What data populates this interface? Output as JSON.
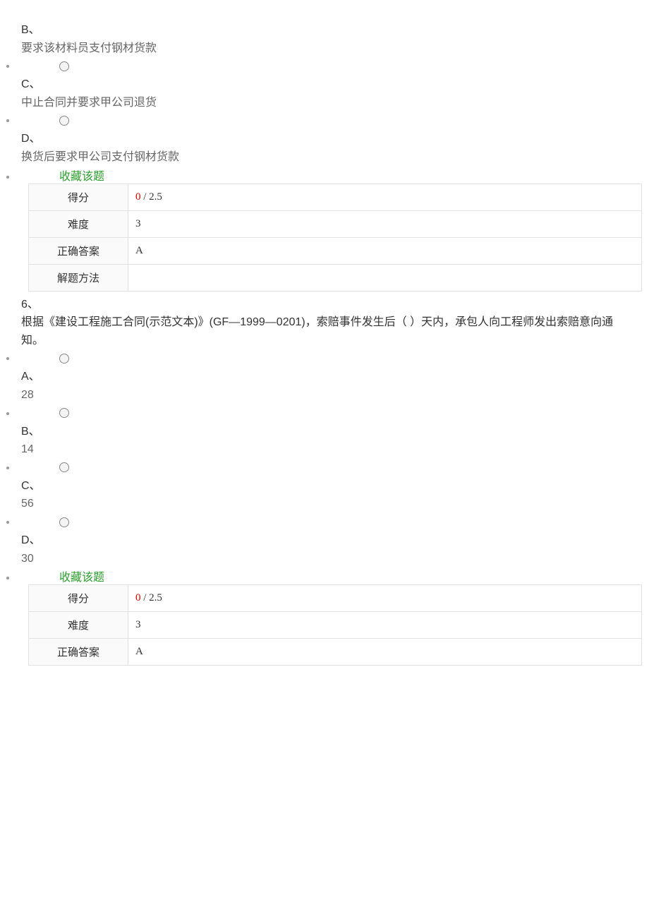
{
  "q5": {
    "options": {
      "B": {
        "label": "B、",
        "text": "要求该材料员支付钢材货款"
      },
      "C": {
        "label": "C、",
        "text": "中止合同并要求甲公司退货"
      },
      "D": {
        "label": "D、",
        "text": "换货后要求甲公司支付钢材货款"
      }
    },
    "favorite": "收藏该题",
    "table": {
      "score_label": "得分",
      "score_got": "0",
      "score_sep": " / ",
      "score_total": "2.5",
      "difficulty_label": "难度",
      "difficulty_value": "3",
      "answer_label": "正确答案",
      "answer_value": "A",
      "method_label": "解题方法",
      "method_value": ""
    }
  },
  "q6": {
    "number": "6、",
    "stem": "根据《建设工程施工合同(示范文本)》(GF—1999—0201)，索赔事件发生后（ ）天内，承包人向工程师发出索赔意向通知。",
    "options": {
      "A": {
        "label": "A、",
        "text": "28"
      },
      "B": {
        "label": "B、",
        "text": "14"
      },
      "C": {
        "label": "C、",
        "text": "56"
      },
      "D": {
        "label": "D、",
        "text": "30"
      }
    },
    "favorite": "收藏该题",
    "table": {
      "score_label": "得分",
      "score_got": "0",
      "score_sep": " / ",
      "score_total": "2.5",
      "difficulty_label": "难度",
      "difficulty_value": "3",
      "answer_label": "正确答案",
      "answer_value": "A"
    }
  }
}
